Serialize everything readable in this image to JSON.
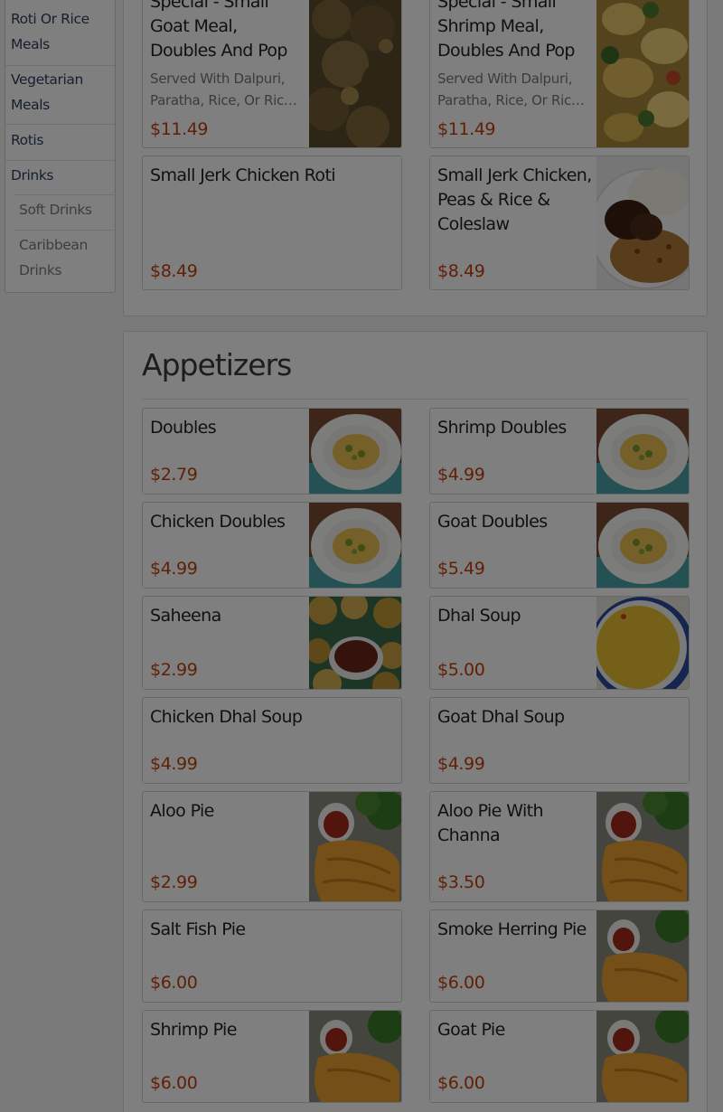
{
  "sidebar": {
    "items": [
      {
        "label1": "Roti Or Rice",
        "label2": "Meals"
      },
      {
        "label1": "Vegetarian",
        "label2": "Meals"
      },
      {
        "label1": "Rotis"
      },
      {
        "label1": "Drinks"
      },
      {
        "label1": "Soft Drinks"
      },
      {
        "label1": "Caribbean",
        "label2": "Drinks"
      }
    ]
  },
  "specials": [
    {
      "name_lines": [
        "Special - Small",
        "Goat Meal,",
        "Doubles And Pop"
      ],
      "desc_lines": [
        "Served With Dalpuri,",
        "Paratha, Rice, Or Ric…"
      ],
      "price": "$11.49",
      "image": "goat-curry"
    },
    {
      "name_lines": [
        "Special - Small",
        "Shrimp Meal,",
        "Doubles And Pop"
      ],
      "desc_lines": [
        "Served With Dalpuri,",
        "Paratha, Rice, Or Ric…"
      ],
      "price": "$11.49",
      "image": "shrimp-curry"
    },
    {
      "name_lines": [
        "Small Jerk Chicken Roti"
      ],
      "price": "$8.49",
      "image": null
    },
    {
      "name_lines": [
        "Small Jerk Chicken,",
        "Peas & Rice &",
        "Coleslaw"
      ],
      "price": "$8.49",
      "image": "jerk-chicken-rice"
    }
  ],
  "appetizers": {
    "title": "Appetizers",
    "items": [
      {
        "name_lines": [
          "Doubles"
        ],
        "price": "$2.79",
        "image": "doubles"
      },
      {
        "name_lines": [
          "Shrimp Doubles"
        ],
        "price": "$4.99",
        "image": "doubles"
      },
      {
        "name_lines": [
          "Chicken Doubles"
        ],
        "price": "$4.99",
        "image": "doubles"
      },
      {
        "name_lines": [
          "Goat Doubles"
        ],
        "price": "$5.49",
        "image": "doubles"
      },
      {
        "name_lines": [
          "Saheena"
        ],
        "price": "$2.99",
        "image": "saheena"
      },
      {
        "name_lines": [
          "Dhal Soup"
        ],
        "price": "$5.00",
        "image": "dhal-soup"
      },
      {
        "name_lines": [
          "Chicken Dhal Soup"
        ],
        "price": "$4.99",
        "image": null
      },
      {
        "name_lines": [
          "Goat Dhal Soup"
        ],
        "price": "$4.99",
        "image": null
      },
      {
        "name_lines": [
          "Aloo Pie"
        ],
        "price": "$2.99",
        "image": "aloo-pie"
      },
      {
        "name_lines": [
          "Aloo Pie With",
          "Channa"
        ],
        "price": "$3.50",
        "image": "aloo-pie"
      },
      {
        "name_lines": [
          "Salt Fish Pie"
        ],
        "price": "$6.00",
        "image": null
      },
      {
        "name_lines": [
          "Smoke Herring Pie"
        ],
        "price": "$6.00",
        "image": "aloo-pie"
      },
      {
        "name_lines": [
          "Shrimp Pie"
        ],
        "price": "$6.00",
        "image": "aloo-pie"
      },
      {
        "name_lines": [
          "Goat Pie"
        ],
        "price": "$6.00",
        "image": "aloo-pie"
      }
    ]
  },
  "colors": {
    "price": "#c2410c",
    "overlay": "rgba(0,0,0,0.5)"
  }
}
